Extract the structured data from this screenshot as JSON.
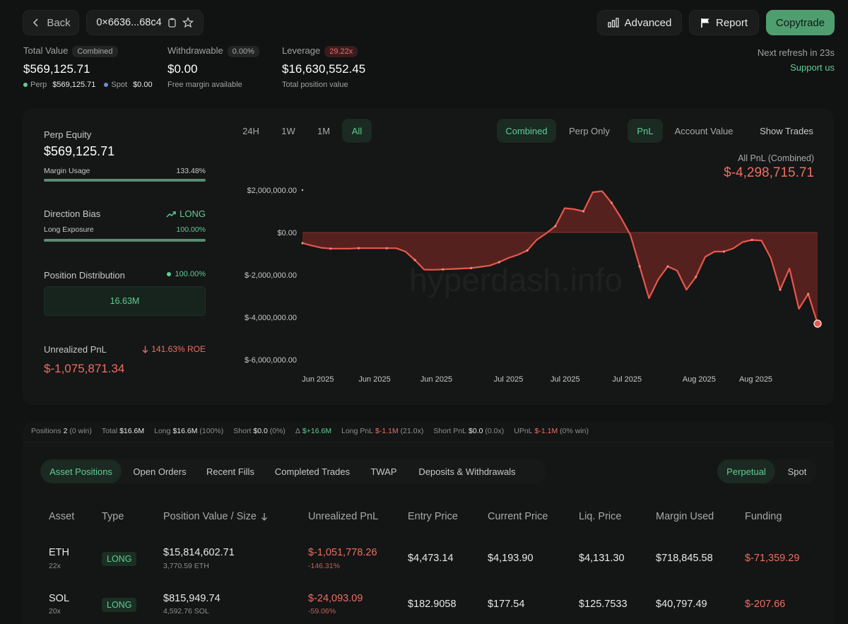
{
  "header": {
    "back_label": "Back",
    "address": "0×6636...68c4",
    "advanced_label": "Advanced",
    "report_label": "Report",
    "copytrade_label": "Copytrade"
  },
  "summary": {
    "total_value_label": "Total Value",
    "total_value_badge": "Combined",
    "total_value": "$569,125.71",
    "perp_label": "Perp",
    "perp_value": "$569,125.71",
    "spot_label": "Spot",
    "spot_value": "$0.00",
    "withdrawable_label": "Withdrawable",
    "withdrawable_badge": "0.00%",
    "withdrawable_value": "$0.00",
    "withdrawable_sub": "Free margin available",
    "leverage_label": "Leverage",
    "leverage_badge": "29.22x",
    "leverage_value": "$16,630,552.45",
    "leverage_sub": "Total position value",
    "refresh_text": "Next refresh in 23s",
    "support_link": "Support us"
  },
  "left_panel": {
    "perp_equity_label": "Perp Equity",
    "perp_equity_value": "$569,125.71",
    "margin_usage_label": "Margin Usage",
    "margin_usage_value": "133.48%",
    "direction_bias_label": "Direction Bias",
    "direction_bias_value": "LONG",
    "long_exposure_label": "Long Exposure",
    "long_exposure_value": "100.00%",
    "long_exposure_fraction": 1.0,
    "position_distribution_label": "Position Distribution",
    "position_distribution_value": "100.00%",
    "distribution_bar_label": "16.63M",
    "unrealized_pnl_label": "Unrealized PnL",
    "unrealized_pnl_roe": "141.63% ROE",
    "unrealized_pnl_value": "$-1,075,871.34"
  },
  "chart_controls": {
    "ranges": [
      "24H",
      "1W",
      "1M",
      "All"
    ],
    "active_range": "All",
    "modes": [
      "Combined",
      "Perp Only"
    ],
    "active_mode": "Combined",
    "metrics": [
      "PnL",
      "Account Value"
    ],
    "active_metric": "PnL",
    "show_trades_label": "Show Trades",
    "pnl_title": "All PnL (Combined)",
    "pnl_value": "$-4,298,715.71",
    "watermark": "hyperdash.info"
  },
  "chart_data": {
    "type": "area",
    "y_tick_labels": [
      "$2,000,000.00",
      "$0.00",
      "$-2,000,000.00",
      "$-4,000,000.00",
      "$-6,000,000.00"
    ],
    "y_ticks": [
      2000000,
      0,
      -2000000,
      -4000000,
      -6000000
    ],
    "ylim": [
      -6000000,
      2000000
    ],
    "x_tick_labels": [
      "Jun 2025",
      "Jun 2025",
      "Jun 2025",
      "Jul 2025",
      "Jul 2025",
      "Jul 2025",
      "Aug 2025",
      "Aug 2025"
    ],
    "series": [
      {
        "values": [
          -500000,
          -620000,
          -720000,
          -760000,
          -760000,
          -760000,
          -740000,
          -740000,
          -740000,
          -740000,
          -740000,
          -900000,
          -1300000,
          -1750000,
          -1760000,
          -1740000,
          -1720000,
          -1700000,
          -1680000,
          -1620000,
          -1560000,
          -1400000,
          -1200000,
          -1050000,
          -850000,
          -350000,
          -50000,
          300000,
          1150000,
          1100000,
          1000000,
          1900000,
          1950000,
          1400000,
          700000,
          -100000,
          -1600000,
          -3100000,
          -2200000,
          -1600000,
          -1800000,
          -2700000,
          -2100000,
          -1150000,
          -900000,
          -900000,
          -750000,
          -450000,
          -350000,
          -380000,
          -1200000,
          -2700000,
          -1700000,
          -3600000,
          -2900000,
          -4298715
        ]
      }
    ],
    "color": "#e8574c"
  },
  "stats": [
    {
      "label": "Positions",
      "value": "2",
      "extra": "(0 win)"
    },
    {
      "label": "Total",
      "value": "$16.6M",
      "extra": ""
    },
    {
      "label": "Long",
      "value": "$16.6M",
      "extra": "(100%)"
    },
    {
      "label": "Short",
      "value": "$0.0",
      "extra": "(0%)"
    },
    {
      "label": "Δ",
      "value": "$+16.6M",
      "extra": ""
    },
    {
      "label": "Long PnL",
      "value": "$-1.1M",
      "extra": "(21.0x)"
    },
    {
      "label": "Short PnL",
      "value": "$0.0",
      "extra": "(0.0x)"
    },
    {
      "label": "UPnL",
      "value": "$-1.1M",
      "extra": "(0% win)"
    }
  ],
  "table_tabs": [
    "Asset Positions",
    "Open Orders",
    "Recent Fills",
    "Completed Trades",
    "TWAP",
    "Deposits & Withdrawals"
  ],
  "active_table_tab": "Asset Positions",
  "market_tabs": [
    "Perpetual",
    "Spot"
  ],
  "active_market_tab": "Perpetual",
  "table": {
    "headers": [
      "Asset",
      "Type",
      "Position Value / Size",
      "Unrealized PnL",
      "Entry Price",
      "Current Price",
      "Liq. Price",
      "Margin Used",
      "Funding"
    ],
    "rows": [
      {
        "asset": "ETH",
        "leverage": "22x",
        "type": "LONG",
        "value": "$15,814,602.71",
        "size": "3,770.59 ETH",
        "upnl": "$-1,051,778.26",
        "upnl_pct": "-146.31%",
        "entry": "$4,473.14",
        "current": "$4,193.90",
        "liq": "$4,131.30",
        "margin": "$718,845.58",
        "funding": "$-71,359.29"
      },
      {
        "asset": "SOL",
        "leverage": "20x",
        "type": "LONG",
        "value": "$815,949.74",
        "size": "4,592.76 SOL",
        "upnl": "$-24,093.09",
        "upnl_pct": "-59.06%",
        "entry": "$182.9058",
        "current": "$177.54",
        "liq": "$125.7533",
        "margin": "$40,797.49",
        "funding": "$-207.66"
      }
    ]
  },
  "colors": {
    "accent_green": "#5fce93",
    "loss_red": "#ee6e63",
    "copytrade_bg": "#4f9e70"
  }
}
